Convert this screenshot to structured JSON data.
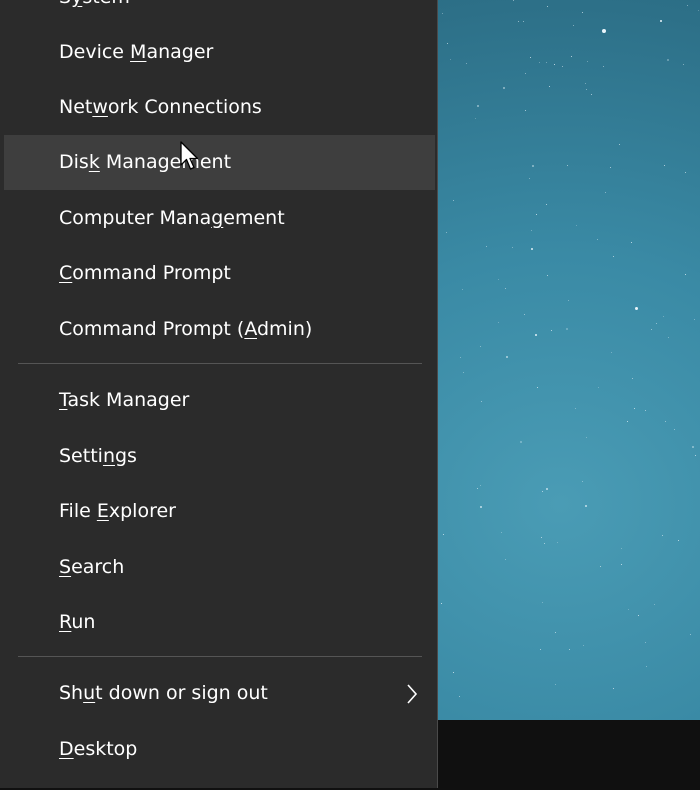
{
  "menu": {
    "items": [
      {
        "pre": "S",
        "key": "y",
        "post": "stem"
      },
      {
        "pre": "Device ",
        "key": "M",
        "post": "anager"
      },
      {
        "pre": "Net",
        "key": "w",
        "post": "ork Connections"
      },
      {
        "pre": "Dis",
        "key": "k",
        "post": " Management",
        "hover": true
      },
      {
        "pre": "Computer Mana",
        "key": "g",
        "post": "ement"
      },
      {
        "pre": "",
        "key": "C",
        "post": "ommand Prompt"
      },
      {
        "pre": "Command Prompt (",
        "key": "A",
        "post": "dmin)"
      },
      {
        "pre": "",
        "key": "T",
        "post": "ask Manager"
      },
      {
        "pre": "Setti",
        "key": "n",
        "post": "gs"
      },
      {
        "pre": "File ",
        "key": "E",
        "post": "xplorer"
      },
      {
        "pre": "",
        "key": "S",
        "post": "earch"
      },
      {
        "pre": "",
        "key": "R",
        "post": "un"
      },
      {
        "pre": "Sh",
        "key": "u",
        "post": "t down or sign out",
        "submenu": true
      },
      {
        "pre": "",
        "key": "D",
        "post": "esktop"
      }
    ]
  },
  "colors": {
    "menu_bg": "#2b2b2b",
    "hover_bg": "#3e3e3e",
    "separator": "#555555",
    "text": "#ffffff",
    "taskbar": "#101010",
    "wallpaper": "#3a8aa5"
  },
  "icons": {
    "submenu": "chevron-right-icon",
    "cursor": "mouse-pointer-icon"
  }
}
